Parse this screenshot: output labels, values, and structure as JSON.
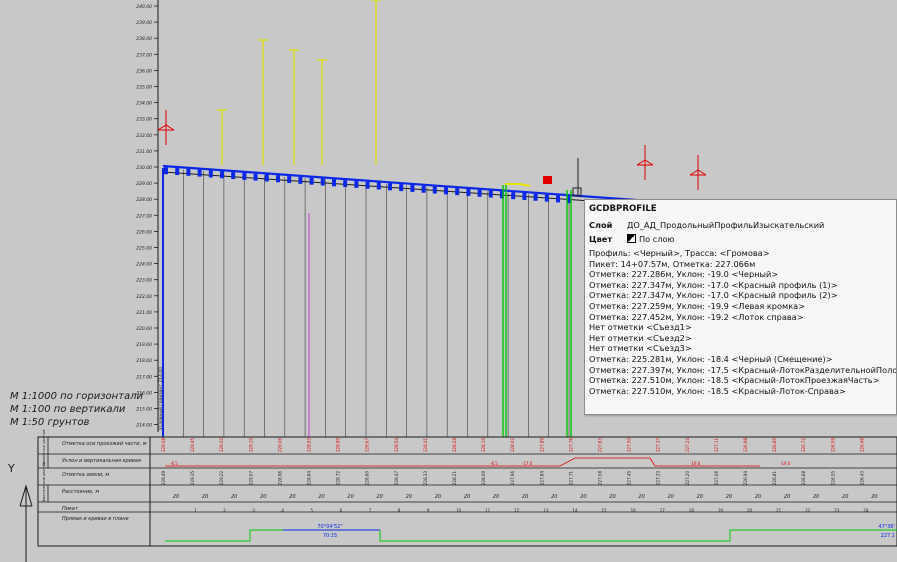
{
  "drawing": {
    "scale_notes": [
      "M 1:1000 по горизонтали",
      "M 1:100 по вертикали",
      "M 1:50 грунтов"
    ],
    "table_rows": [
      "Отметка оси проезжей части, м",
      "Уклон и вертикальная кривая",
      "Отметка земли, м",
      "Расстояние, м",
      "Пикет",
      "Прямая и кривая в плане"
    ],
    "table_side_group_1": "Проектные данные",
    "table_side_group_2": "Фактические данные",
    "axis_labels": [
      "240.00",
      "239.00",
      "238.00",
      "237.00",
      "236.00",
      "235.00",
      "234.00",
      "233.00",
      "232.00",
      "231.00",
      "230.00",
      "229.00",
      "228.00",
      "227.00",
      "226.00",
      "225.00",
      "224.00",
      "223.00",
      "222.00",
      "221.00",
      "220.00",
      "219.00",
      "218.00",
      "217.00",
      "216.00",
      "215.00",
      "214.00"
    ],
    "vertical_annotation": "Условный горизонт 214.00",
    "distances": [
      "20",
      "20",
      "20",
      "20",
      "20",
      "20",
      "20",
      "20",
      "20",
      "20",
      "20",
      "20",
      "20",
      "20",
      "20",
      "20",
      "20",
      "20",
      "20",
      "20",
      "20",
      "20",
      "20",
      "20",
      "20",
      "20",
      "20"
    ],
    "pickets": [
      "",
      "1",
      "2",
      "3",
      "4",
      "5",
      "6",
      "7",
      "8",
      "9",
      "10",
      "11",
      "12",
      "13",
      "14",
      "15",
      "16",
      "17",
      "18",
      "19",
      "20",
      "21",
      "22",
      "23",
      "24"
    ],
    "plan_curve_left": "70°04'52\"",
    "plan_curve_left_sub": "70.15",
    "plan_right_value": "47°36'",
    "plan_right_sub": "227.1",
    "design_elevations": [
      "229.58",
      "229.45",
      "229.32",
      "229.19",
      "229.06",
      "228.93",
      "228.80",
      "228.67",
      "228.54",
      "228.41",
      "228.28",
      "228.15",
      "228.02",
      "227.89",
      "227.76",
      "227.63",
      "227.50",
      "227.37",
      "227.24",
      "227.11",
      "226.98",
      "226.85",
      "226.72",
      "226.59",
      "226.46",
      "226.33"
    ],
    "ground_elevations": [
      "229.49",
      "229.35",
      "229.22",
      "229.07",
      "228.96",
      "228.84",
      "228.72",
      "228.60",
      "228.47",
      "228.33",
      "228.21",
      "228.09",
      "227.96",
      "227.84",
      "227.71",
      "227.58",
      "227.45",
      "227.33",
      "227.20",
      "227.06",
      "226.94",
      "226.81",
      "226.68",
      "226.55",
      "226.43",
      "226.30"
    ],
    "slope_labels": [
      "-6.5",
      "-6.5",
      "-17.0",
      "-19.0",
      "-19.0"
    ]
  },
  "tooltip": {
    "command": "GCDBPROFILE",
    "layer_label": "Слой",
    "layer_value": "ДО_АД_ПродольныйПрофильИзыскательский",
    "color_label": "Цвет",
    "color_value": "По слою",
    "lines": [
      "Профиль: <Черный>, Трасса: <Громова>",
      "Пикет: 14+07.57м, Отметка: 227.066м",
      "Отметка: 227.286м, Уклон: -19.0 <Черный>",
      "Отметка: 227.347м, Уклон: -17.0 <Красный профиль (1)>",
      "Отметка: 227.347м, Уклон: -17.0 <Красный профиль (2)>",
      "Отметка: 227.259м, Уклон: -19.9 <Левая кромка>",
      "Отметка: 227.452м, Уклон: -19.2 <Лоток справа>",
      "Нет отметки <Съезд1>",
      "Нет отметки <Съезд2>",
      "Нет отметки <Съезд3>",
      "Отметка: 225.281м, Уклон: -18.4 <Черный (Смещение)>",
      "Отметка: 227.397м, Уклон: -17.5 <Красный-ЛотокРазделительнойПолосы>",
      "Отметка: 227.510м, Уклон: -18.5 <Красный-ЛотокПроезжаяЧасть>",
      "Отметка: 227.510м, Уклон: -18.5 <Красный-Лоток-Справа>"
    ]
  },
  "ucs": {
    "y_label": "Y"
  },
  "colors": {
    "background": "#c8c8c8",
    "profile_blue": "#0a28e6",
    "design_red": "#e00000",
    "marker_yellow": "#e6e600",
    "grid_black": "#1a1a1a",
    "green": "#00c800",
    "magenta": "#d23cd2"
  }
}
